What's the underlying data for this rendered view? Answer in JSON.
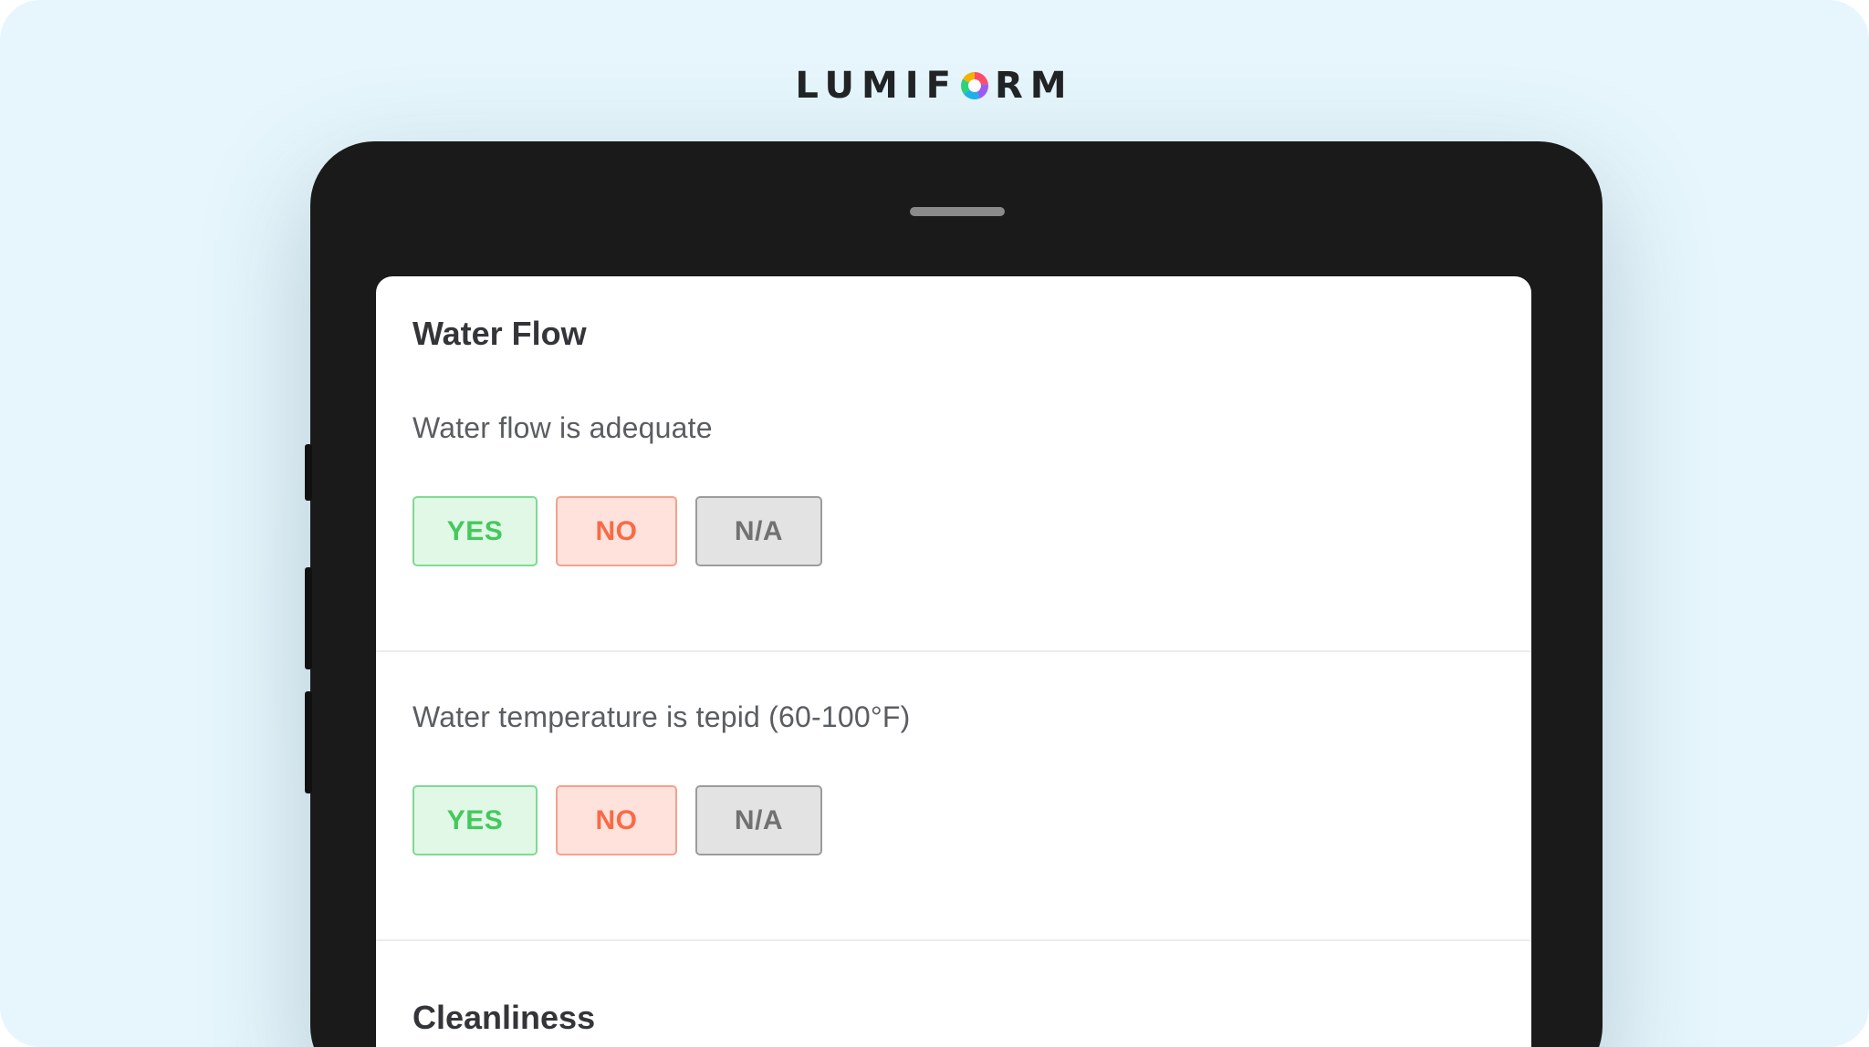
{
  "brand": {
    "name_left": "LUMIF",
    "name_right": "RM",
    "mark_colors": [
      "#f5b400",
      "#ff4d6d",
      "#9b5cf6",
      "#20b2e8",
      "#2ed47a"
    ]
  },
  "form": {
    "sections": [
      {
        "title": "Water Flow",
        "questions": [
          {
            "text": "Water flow is adequate",
            "options": [
              "YES",
              "NO",
              "N/A"
            ]
          },
          {
            "text": "Water temperature is tepid (60-100°F)",
            "options": [
              "YES",
              "NO",
              "N/A"
            ]
          }
        ]
      },
      {
        "title": "Cleanliness"
      }
    ]
  },
  "colors": {
    "background": "#e6f6fc",
    "device": "#1a1a1a",
    "yes": "#43c95c",
    "no": "#fa6a45",
    "na": "#717171"
  }
}
